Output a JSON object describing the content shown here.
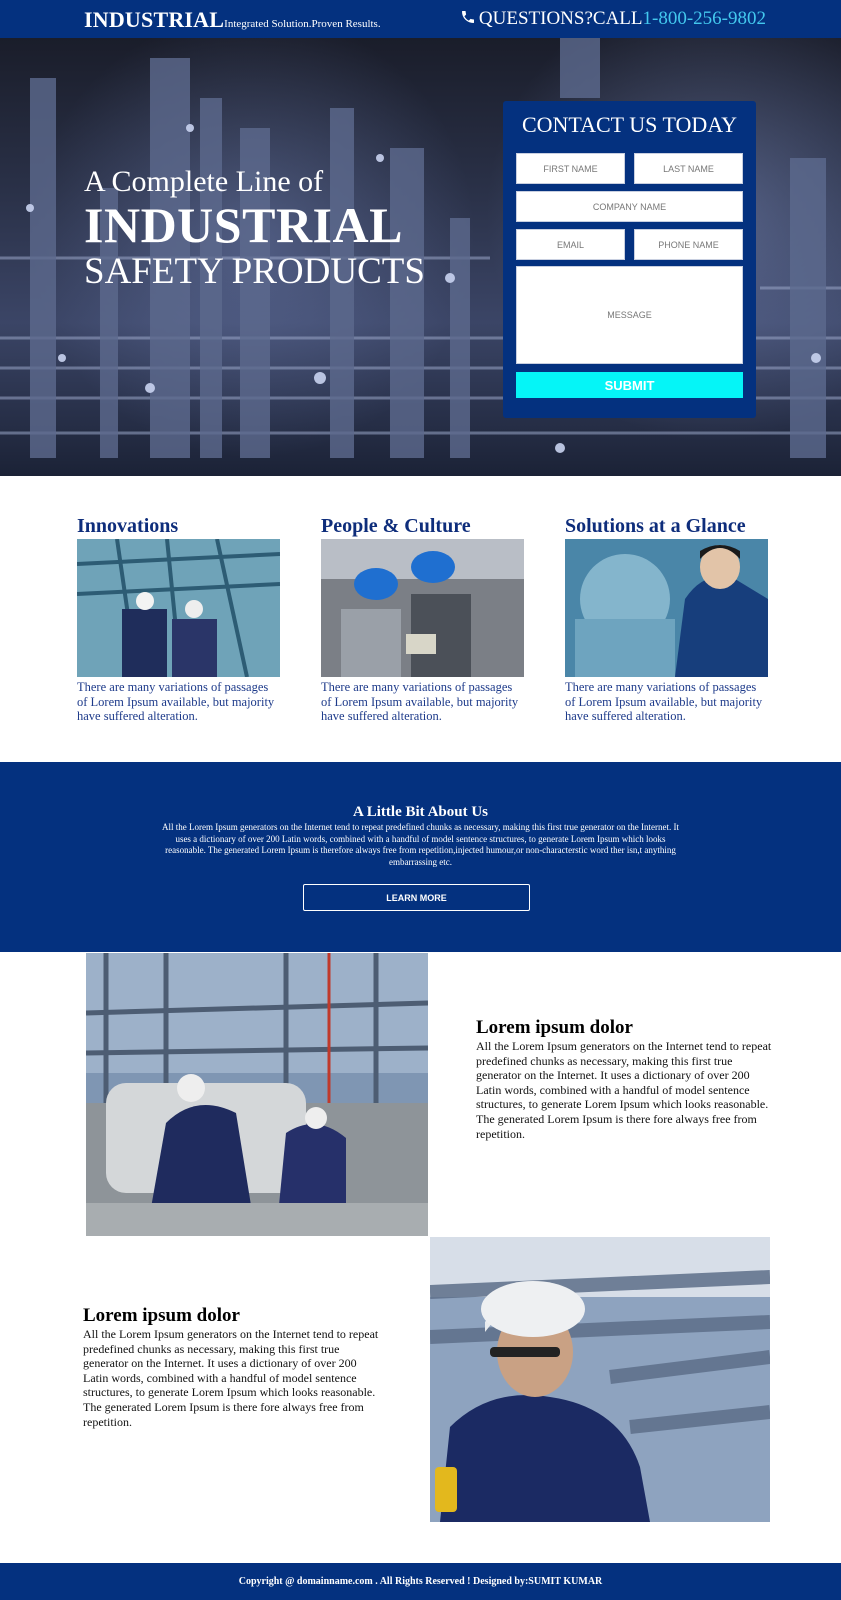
{
  "header": {
    "logo": "INDUSTRIAL",
    "tagline": "Integrated Solution.Proven Results.",
    "phone_prefix": "QUESTIONS?CALL",
    "phone_number": "1-800-256-9802",
    "phone_icon": "phone-icon"
  },
  "hero": {
    "line1": "A Complete Line of",
    "line2": "INDUSTRIAL",
    "line3": "SAFETY PRODUCTS"
  },
  "contact_form": {
    "title": "CONTACT US TODAY",
    "first_name_placeholder": "FIRST NAME",
    "last_name_placeholder": "LAST NAME",
    "company_placeholder": "COMPANY NAME",
    "email_placeholder": "EMAIL",
    "phone_placeholder": "PHONE NAME",
    "message_placeholder": "MESSAGE",
    "submit_label": "SUBMIT"
  },
  "features": [
    {
      "title": "Innovations",
      "text": "There are many variations of passages of Lorem Ipsum available, but majority have suffered alteration."
    },
    {
      "title": "People & Culture",
      "text": "There are many variations of passages of Lorem Ipsum available, but majority have suffered alteration."
    },
    {
      "title": "Solutions at a Glance",
      "text": "There are many variations of passages of Lorem Ipsum available, but majority have suffered alteration."
    }
  ],
  "about": {
    "title": "A Little Bit About Us",
    "text": "All the Lorem Ipsum generators on the Internet tend to repeat predefined chunks as necessary, making this first true generator on the Internet. It uses a dictionary of over 200 Latin words, combined with a handful of model sentence structures, to generate Lorem Ipsum which looks reasonable. The generated Lorem Ipsum is therefore always free from repetition,injected humour,or non-characterstic word ther isn,t anything embarrassing etc.",
    "button_label": "LEARN MORE"
  },
  "section1": {
    "title": "Lorem ipsum dolor",
    "text": "All the Lorem Ipsum generators on the Internet tend to repeat predefined chunks as necessary, making this first true generator on the Internet. It uses a dictionary of over 200 Latin words, combined with a handful of model sentence structures, to generate Lorem Ipsum which looks reasonable. The generated Lorem Ipsum is there fore always free from repetition."
  },
  "section2": {
    "title": "Lorem ipsum dolor",
    "text": "All the Lorem Ipsum generators on the Internet tend to repeat predefined chunks as necessary, making this first true generator on the Internet. It uses a dictionary of over 200 Latin words, combined with a handful of model sentence structures, to generate Lorem Ipsum which looks reasonable. The generated Lorem Ipsum is there fore always free from repetition."
  },
  "footer": {
    "text": "Copyright @ domainname.com . All Rights Reserved ! Designed by:SUMIT KUMAR"
  },
  "colors": {
    "brand_blue": "#04317f",
    "phone_accent": "#43c8ee",
    "submit_cyan": "#05f5f7",
    "heading_blue": "#0e2d7b"
  }
}
